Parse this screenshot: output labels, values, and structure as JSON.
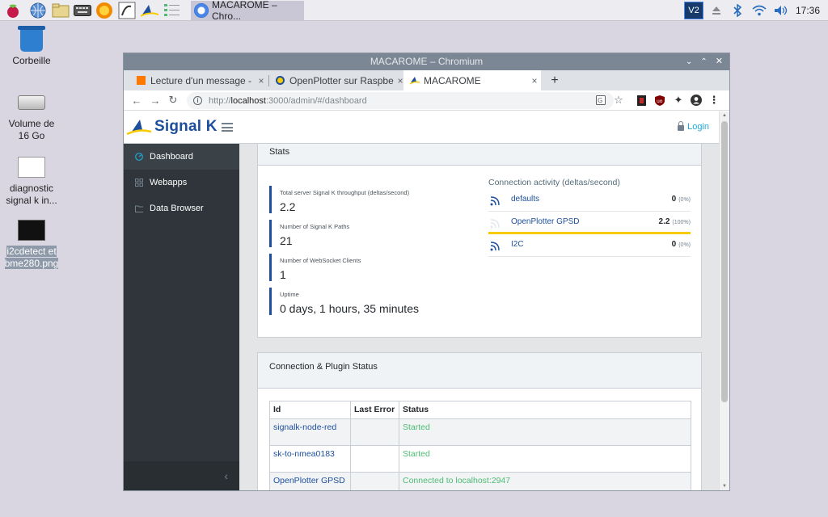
{
  "taskbar": {
    "active_task": "MACAROME – Chro...",
    "clock": "17:36",
    "launchers": [
      "raspberry-menu-icon",
      "web-browser-icon",
      "file-manager-icon",
      "keyboard-icon",
      "sun-icon",
      "editor-icon",
      "signalk-launcher-icon",
      "config-icon"
    ],
    "tray": [
      "vnc-icon",
      "eject-icon",
      "bluetooth-icon",
      "wifi-icon",
      "volume-icon"
    ]
  },
  "desktop": {
    "icons": [
      {
        "label": "Corbeille"
      },
      {
        "label": "Volume de 16 Go"
      },
      {
        "label": "diagnostic signal k in..."
      },
      {
        "label": "i2cdetect et bme280.png"
      }
    ]
  },
  "window": {
    "title": "MACAROME – Chromium"
  },
  "tabs": [
    {
      "title": "Lecture d'un message - m",
      "close": "×"
    },
    {
      "title": "OpenPlotter sur Raspberr",
      "close": "×"
    },
    {
      "title": "MACAROME",
      "close": "×"
    }
  ],
  "newtab": "+",
  "address": {
    "scheme": "http://",
    "host": "localhost",
    "path": ":3000/admin/#/dashboard"
  },
  "header": {
    "logo_text": "Signal K",
    "login": "Login"
  },
  "sidebar": {
    "items": [
      {
        "label": "Dashboard",
        "icon": "dashboard-icon"
      },
      {
        "label": "Webapps",
        "icon": "grid-icon"
      },
      {
        "label": "Data Browser",
        "icon": "folder-icon"
      }
    ],
    "minimizer": "‹"
  },
  "stats": {
    "title": "Stats",
    "items": [
      {
        "label": "Total server Signal K throughput (deltas/second)",
        "value": "2.2"
      },
      {
        "label": "Number of Signal K Paths",
        "value": "21"
      },
      {
        "label": "Number of WebSocket Clients",
        "value": "1"
      },
      {
        "label": "Uptime",
        "value": "0 days, 1 hours, 35 minutes"
      }
    ],
    "connection_title": "Connection activity (deltas/second)",
    "connections": [
      {
        "name": "defaults",
        "value": "0",
        "pct": "(0%)",
        "fill": 0
      },
      {
        "name": "OpenPlotter GPSD",
        "value": "2.2",
        "pct": "(100%)",
        "fill": 1.0
      },
      {
        "name": "I2C",
        "value": "0",
        "pct": "(0%)",
        "fill": 0
      }
    ]
  },
  "plugins": {
    "title": "Connection & Plugin Status",
    "columns": [
      "Id",
      "Last Error",
      "Status"
    ],
    "rows": [
      {
        "id": "signalk-node-red",
        "error": "",
        "status": "Started"
      },
      {
        "id": "sk-to-nmea0183",
        "error": "",
        "status": "Started"
      },
      {
        "id": "OpenPlotter GPSD",
        "error": "",
        "status": "Connected to localhost:2947"
      }
    ]
  },
  "colors": {
    "brand": "#1d4f9c",
    "sidebar": "#2f353a",
    "activity_bar": "#f8cb00",
    "status_ok": "#4dbd74"
  }
}
